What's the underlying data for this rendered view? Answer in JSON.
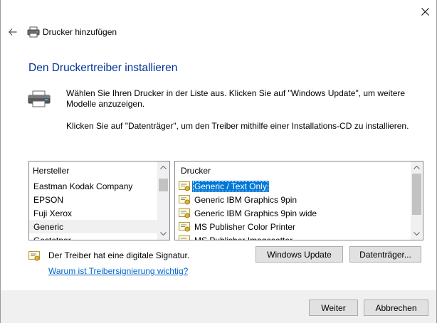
{
  "window": {
    "title": "Drucker hinzufügen",
    "icons": {
      "close": "close-icon",
      "back": "back-arrow-icon",
      "title": "printer-icon"
    }
  },
  "page": {
    "heading": "Den Druckertreiber installieren",
    "description_1": "Wählen Sie Ihren Drucker in der Liste aus. Klicken Sie auf \"Windows Update\", um weitere Modelle anzuzeigen.",
    "description_2": "Klicken Sie auf \"Datenträger\", um den Treiber mithilfe einer Installations-CD zu installieren."
  },
  "manufacturers": {
    "header": "Hersteller",
    "items": [
      "Eastman Kodak Company",
      "EPSON",
      "Fuji Xerox",
      "Generic",
      "Gestetner"
    ],
    "selected": "Generic"
  },
  "printers": {
    "header": "Drucker",
    "items": [
      "Generic / Text Only",
      "Generic IBM Graphics 9pin",
      "Generic IBM Graphics 9pin wide",
      "MS Publisher Color Printer",
      "MS Publisher Imagesetter"
    ],
    "selected": "Generic / Text Only",
    "item_icon": "certificate-icon"
  },
  "signature": {
    "text": "Der Treiber hat eine digitale Signatur.",
    "link": "Warum ist Treibersignierung wichtig?"
  },
  "buttons": {
    "windows_update": "Windows Update",
    "disk": "Datenträger...",
    "next": "Weiter",
    "cancel": "Abbrechen"
  },
  "colors": {
    "heading": "#003399",
    "selection": "#0078d7",
    "link": "#0066cc",
    "footer": "#f0f0f0"
  }
}
